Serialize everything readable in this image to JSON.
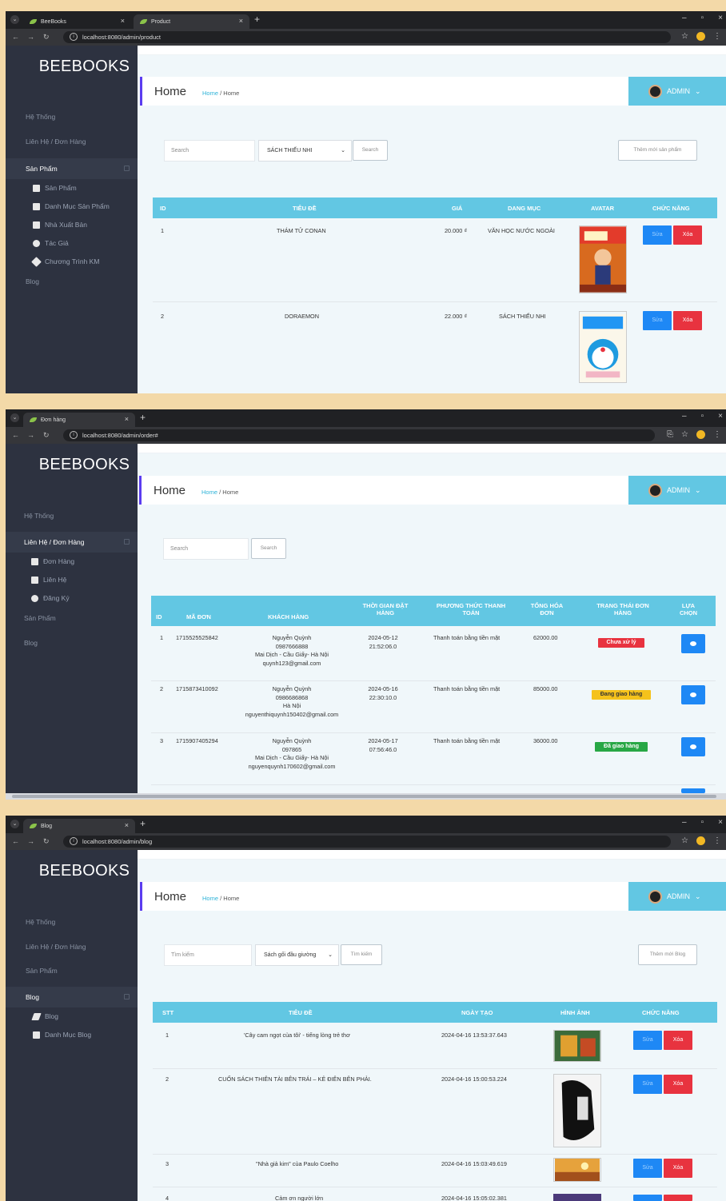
{
  "app_name": "BEEBOOKS",
  "user_label": "ADMIN",
  "page_title": "Home",
  "breadcrumb": {
    "link": "Home",
    "sep": "/",
    "current": "Home"
  },
  "sidebar_sections": {
    "system": "Hệ Thống",
    "contact_orders": "Liên Hệ / Đơn Hàng",
    "products": "Sản Phẩm",
    "blog": "Blog"
  },
  "product_page": {
    "tabs": [
      {
        "title": "BeeBooks"
      },
      {
        "title": "Product"
      }
    ],
    "url": "localhost:8080/admin/product",
    "submenu": [
      "Sản Phẩm",
      "Danh Mục Sản Phẩm",
      "Nhà Xuất Bản",
      "Tác Giả",
      "Chương Trình KM"
    ],
    "search_placeholder": "Search",
    "category_selected": "SÁCH THIẾU NHI",
    "search_button": "Search",
    "add_button": "Thêm mới sản phẩm",
    "columns": [
      "ID",
      "TIÊU ĐỀ",
      "GIÁ",
      "DANG MỤC",
      "AVATAR",
      "CHỨC NĂNG"
    ],
    "rows": [
      {
        "id": "1",
        "title": "THÁM TỬ CONAN",
        "price": "20.000 ₫",
        "category": "VĂN HỌC NƯỚC NGOÀI"
      },
      {
        "id": "2",
        "title": "DORAEMON",
        "price": "22.000 ₫",
        "category": "SÁCH THIẾU NHI"
      }
    ],
    "edit_label": "Sửa",
    "delete_label": "Xóa"
  },
  "order_page": {
    "tab_title": "Đơn hàng",
    "url": "localhost:8080/admin/order#",
    "submenu": [
      "Đơn Hàng",
      "Liên Hệ",
      "Đăng Ký"
    ],
    "search_placeholder": "Search",
    "search_button": "Search",
    "columns": [
      "ID",
      "MÃ ĐƠN",
      "KHÁCH HÀNG",
      "THỜI GIAN ĐẶT HÀNG",
      "PHƯƠNG THỨC THANH TOÁN",
      "TỔNG HÓA ĐƠN",
      "TRẠNG THÁI ĐƠN HÀNG",
      "LỰA CHỌN"
    ],
    "rows": [
      {
        "id": "1",
        "code": "1715525525842",
        "name": "Nguyễn Quỳnh",
        "phone": "0987666888",
        "address": "Mai Dịch - Cầu Giấy- Hà Nội",
        "email": "quynh123@gmail.com",
        "date": "2024-05-12",
        "time": "21:52:06.0",
        "payment": "Thanh toán bằng tiền mặt",
        "total": "62000.00",
        "status": "Chưa xử lý",
        "status_color": "#e8333f",
        "status_text_color": "#ffffff"
      },
      {
        "id": "2",
        "code": "1715873410092",
        "name": "Nguyễn Quỳnh",
        "phone": "0986686868",
        "address": "Hà Nội",
        "email": "nguyenthiquynh150402@gmail.com",
        "date": "2024-05-16",
        "time": "22:30:10.0",
        "payment": "Thanh toán bằng tiền mặt",
        "total": "85000.00",
        "status": "Đang giao hàng",
        "status_color": "#f5c21b",
        "status_text_color": "#333333"
      },
      {
        "id": "3",
        "code": "1715907405294",
        "name": "Nguyễn Quỳnh",
        "phone": "097865",
        "address": "Mai Dịch - Cầu Giấy- Hà Nội",
        "email": "nguyenquynh170602@gmail.com",
        "date": "2024-05-17",
        "time": "07:56:46.0",
        "payment": "Thanh toán bằng tiền mặt",
        "total": "36000.00",
        "status": "Đã giao hàng",
        "status_color": "#28a745",
        "status_text_color": "#ffffff"
      }
    ]
  },
  "blog_page": {
    "tab_title": "Blog",
    "url": "localhost:8080/admin/blog",
    "submenu": [
      "Blog",
      "Danh Mục Blog"
    ],
    "search_placeholder": "Tìm kiếm",
    "category_selected": "Sách gối đầu giường",
    "search_button": "Tìm kiếm",
    "add_button": "Thêm mới Blog",
    "columns": [
      "STT",
      "TIÊU ĐỀ",
      "NGÀY TẠO",
      "HÌNH ẢNH",
      "CHỨC NĂNG"
    ],
    "rows": [
      {
        "stt": "1",
        "title": "'Cây cam ngọt của tôi' - tiếng lòng trẻ thơ",
        "date": "2024-04-16 13:53:37.643"
      },
      {
        "stt": "2",
        "title": "CUỐN SÁCH THIÊN TÀI BÊN TRÁI – KẺ ĐIÊN BÊN PHẢI.",
        "date": "2024-04-16 15:00:53.224"
      },
      {
        "stt": "3",
        "title": "\"Nhà giả kim\" của Paulo Coelho",
        "date": "2024-04-16 15:03:49.619"
      },
      {
        "stt": "4",
        "title": "Cảm ơn người lớn",
        "date": "2024-04-16 15:05:02.381"
      }
    ],
    "edit_label": "Sửa",
    "delete_label": "Xóa"
  }
}
